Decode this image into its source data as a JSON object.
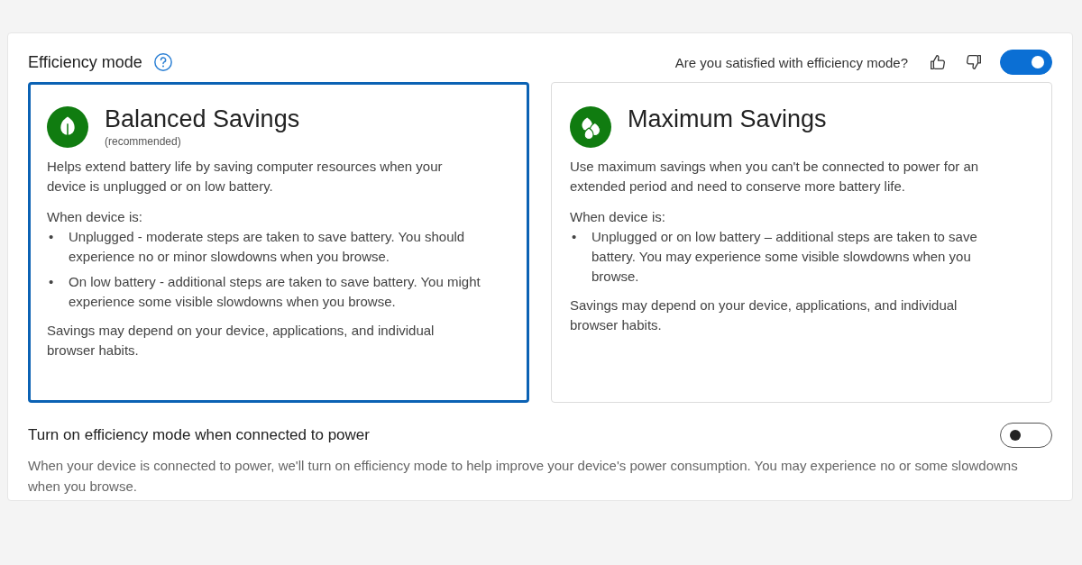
{
  "header": {
    "title": "Efficiency mode",
    "feedback_question": "Are you satisfied with efficiency mode?",
    "toggle": {
      "on": true
    }
  },
  "cards": [
    {
      "title": "Balanced Savings",
      "subtitle": "(recommended)",
      "selected": true,
      "description": "Helps extend battery life by saving computer resources when your device is unplugged or on low battery.",
      "list_heading": "When device is:",
      "bullets": [
        {
          "marker": "•",
          "text": "Unplugged - moderate steps are taken to save battery. You should experience no or minor slowdowns when you browse."
        },
        {
          "marker": "•",
          "text": "On low battery - additional steps are taken to save battery. You might experience some visible slowdowns when you browse."
        }
      ],
      "note": "Savings may depend on your device, applications, and individual browser habits."
    },
    {
      "title": "Maximum Savings",
      "selected": false,
      "description": "Use maximum savings when you can't be connected to power for an extended period and need to conserve more battery life.",
      "list_heading": "When device is:",
      "bullets": [
        {
          "marker": "•",
          "text": "Unplugged or on low battery – additional steps are taken to save battery. You may experience some visible slowdowns when you browse."
        }
      ],
      "note": "Savings may depend on your device, applications, and individual browser habits."
    }
  ],
  "power_setting": {
    "title": "Turn on efficiency mode when connected to power",
    "description": "When your device is connected to power, we'll turn on efficiency mode to help improve your device's power consumption. You may experience no or some slowdowns when you browse.",
    "toggle": {
      "on": false
    }
  }
}
